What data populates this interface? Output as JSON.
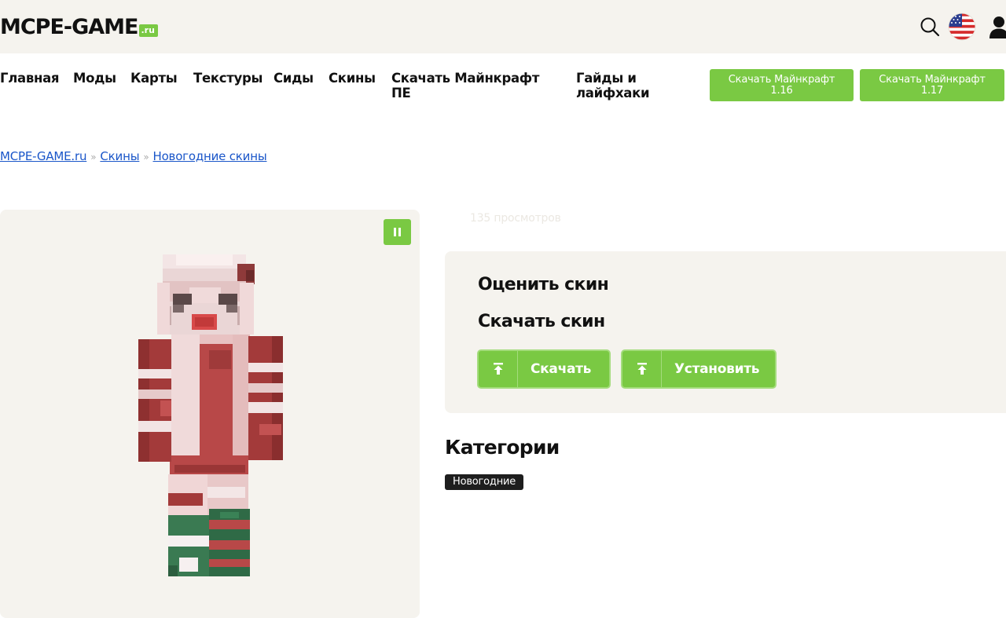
{
  "header": {
    "logo_text": "MCPE-GAME",
    "logo_tld": ".ru",
    "icons": [
      "search-icon",
      "us-flag-icon",
      "user-icon"
    ]
  },
  "nav": {
    "items": [
      {
        "label": "Главная"
      },
      {
        "label": "Моды"
      },
      {
        "label": "Карты"
      },
      {
        "label": "Текстуры"
      },
      {
        "label": "Сиды"
      },
      {
        "label": "Скины"
      },
      {
        "label_line1": "Скачать Майнкрафт",
        "label_line2": "ПЕ"
      },
      {
        "label_line1": "Гайды и",
        "label_line2": "лайфхаки"
      }
    ],
    "buttons": [
      {
        "line1": "Скачать Майнкрафт",
        "line2": "1.16"
      },
      {
        "line1": "Скачать Майнкрафт",
        "line2": "1.17"
      }
    ]
  },
  "breadcrumb": {
    "items": [
      "MCPE-GAME.ru",
      "Скины",
      "Новогодние скины"
    ],
    "separator": "»"
  },
  "skin": {
    "views": "135 просмотров",
    "rate_heading": "Оценить скин",
    "download_heading": "Скачать скин",
    "download_button": "Скачать",
    "install_button": "Установить"
  },
  "categories": {
    "heading": "Категории",
    "tags": [
      "Новогодние"
    ]
  },
  "colors": {
    "accent": "#7ac943",
    "panel_bg": "#f5f3ee",
    "link": "#1a56c9",
    "tag_bg": "#1e1e1e"
  }
}
